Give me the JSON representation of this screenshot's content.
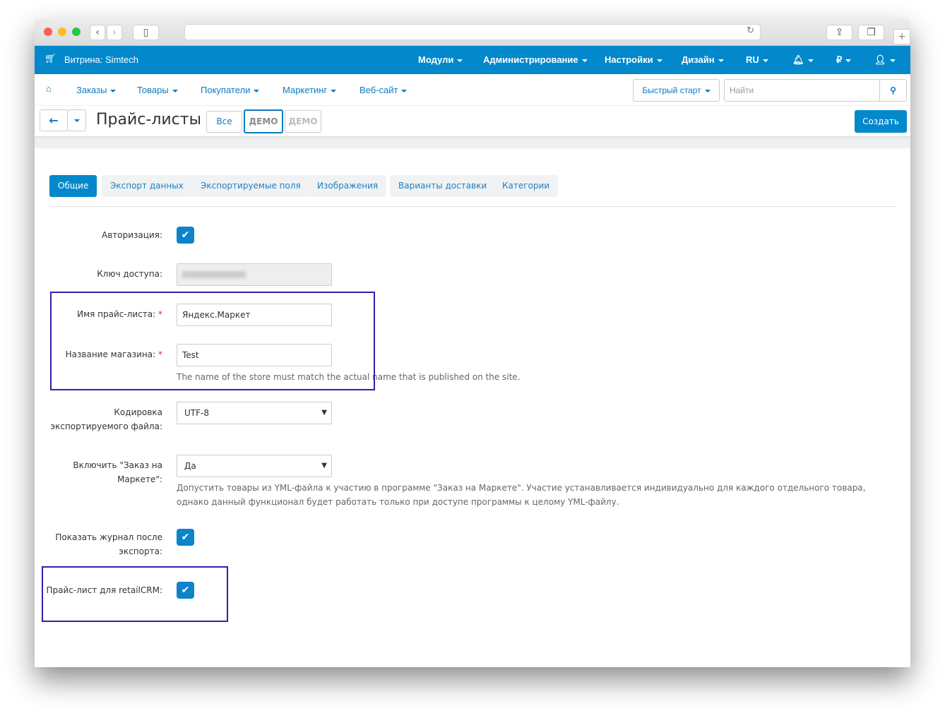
{
  "topbar": {
    "store": "Витрина: Simtech",
    "menu": [
      "Модули",
      "Администрирование",
      "Настройки",
      "Дизайн",
      "RU"
    ],
    "currency": "₽"
  },
  "subnav": {
    "items": [
      "Заказы",
      "Товары",
      "Покупатели",
      "Маркетинг",
      "Веб-сайт"
    ],
    "quick_start": "Быстрый старт",
    "search_placeholder": "Найти"
  },
  "toolbar": {
    "title": "Прайс-листы",
    "all": "Все",
    "demo1": "ДЕМО",
    "demo2": "ДЕМО",
    "create": "Создать"
  },
  "tabs": [
    "Общие",
    "Экспорт данных",
    "Экспортируемые поля",
    "Изображения",
    "Варианты доставки",
    "Категории"
  ],
  "form": {
    "auth_label": "Авторизация:",
    "key_label": "Ключ доступа:",
    "name_label": "Имя прайс-листа:",
    "name_value": "Яндекс.Маркет",
    "shop_label": "Название магазина:",
    "shop_value": "Test",
    "shop_help": "The name of the store must match the actual name that is published on the site.",
    "enc_label": "Кодировка экспортируемого файла:",
    "enc_value": "UTF-8",
    "order_label": "Включить \"Заказ на Маркете\":",
    "order_value": "Да",
    "order_help": "Допустить товары из YML-файла к участию в программе \"Заказ на Маркете\". Участие устанавливается индивидуально для каждого отдельного товара, однако данный функционал будет работать только при доступе программы к целому YML-файлу.",
    "log_label": "Показать журнал после экспорта:",
    "crm_label": "Прайс-лист для retailCRM:",
    "required": "*"
  },
  "colors": {
    "brand": "#0388cc",
    "highlight": "#3b1bb0"
  }
}
